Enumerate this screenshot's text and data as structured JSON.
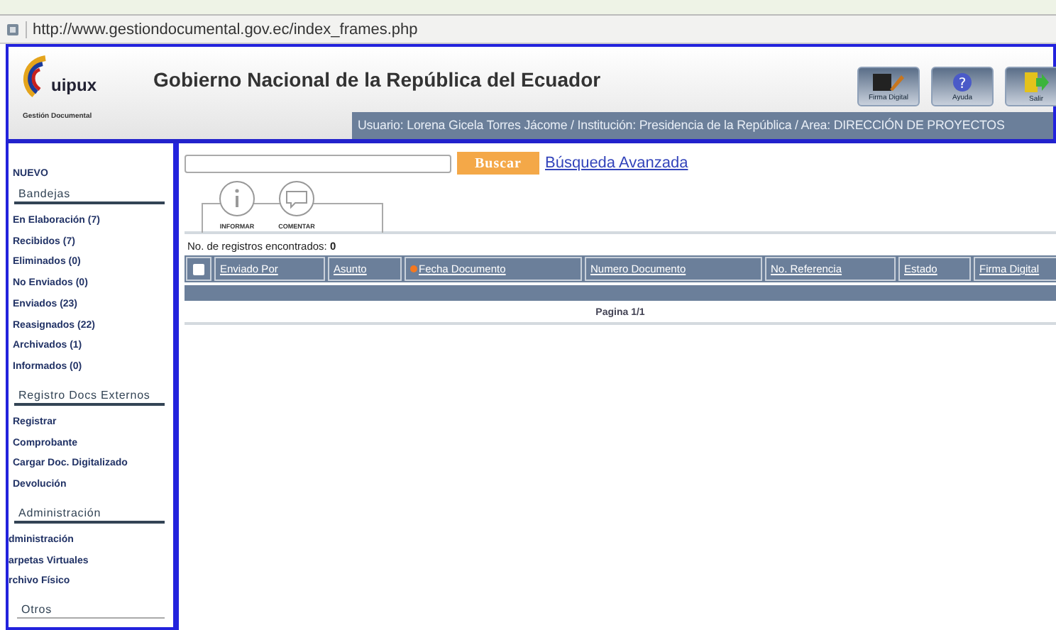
{
  "address_bar": {
    "url": "http://www.gestiondocumental.gov.ec/index_frames.php"
  },
  "header": {
    "logo_text": "uipux",
    "logo_subtitle": "Gestión Documental",
    "title": "Gobierno Nacional de la República del Ecuador",
    "buttons": [
      {
        "kind": "signature",
        "label": "Firma Digital"
      },
      {
        "kind": "help",
        "label": "Ayuda",
        "icon_glyph": "?"
      },
      {
        "kind": "exit",
        "label": "Salir"
      }
    ],
    "user_bar": "Usuario: Lorena Gicela Torres Jácome / Institución: Presidencia de la República / Area: DIRECCIÓN DE PROYECTOS"
  },
  "sidebar": {
    "new_link": "NUEVO",
    "sections": [
      {
        "title": "Bandejas",
        "items": [
          "En Elaboración (7)",
          "Recibidos (7)",
          "Eliminados (0)",
          "No Enviados (0)",
          "Enviados (23)",
          "Reasignados (22)",
          "Archivados (1)",
          "Informados (0)"
        ]
      },
      {
        "title": "Registro Docs Externos",
        "items": [
          "Registrar",
          "Comprobante",
          "Cargar Doc. Digitalizado",
          "Devolución"
        ]
      },
      {
        "title": "Administración",
        "items": [
          "dministración",
          "arpetas Virtuales",
          "rchivo Físico"
        ],
        "cut_left": true
      },
      {
        "title": "Otros"
      }
    ]
  },
  "search": {
    "button": "Buscar",
    "advanced_link": "Búsqueda Avanzada"
  },
  "actions": [
    {
      "kind": "info",
      "label": "INFORMAR"
    },
    {
      "kind": "comment",
      "label": "COMENTAR"
    }
  ],
  "record_count": {
    "label": "No. de registros encontrados:",
    "value": "0"
  },
  "table": {
    "select_all_checked": false,
    "columns": [
      {
        "label": "Enviado Por",
        "sorted": false
      },
      {
        "label": "Asunto",
        "sorted": false
      },
      {
        "label": "Fecha Documento",
        "sorted": true
      },
      {
        "label": "Numero Documento",
        "sorted": false
      },
      {
        "label": "No. Referencia",
        "sorted": false
      },
      {
        "label": "Estado",
        "sorted": false
      },
      {
        "label": "Firma Digital",
        "sorted": false
      }
    ],
    "pagination": "Pagina 1/1"
  }
}
